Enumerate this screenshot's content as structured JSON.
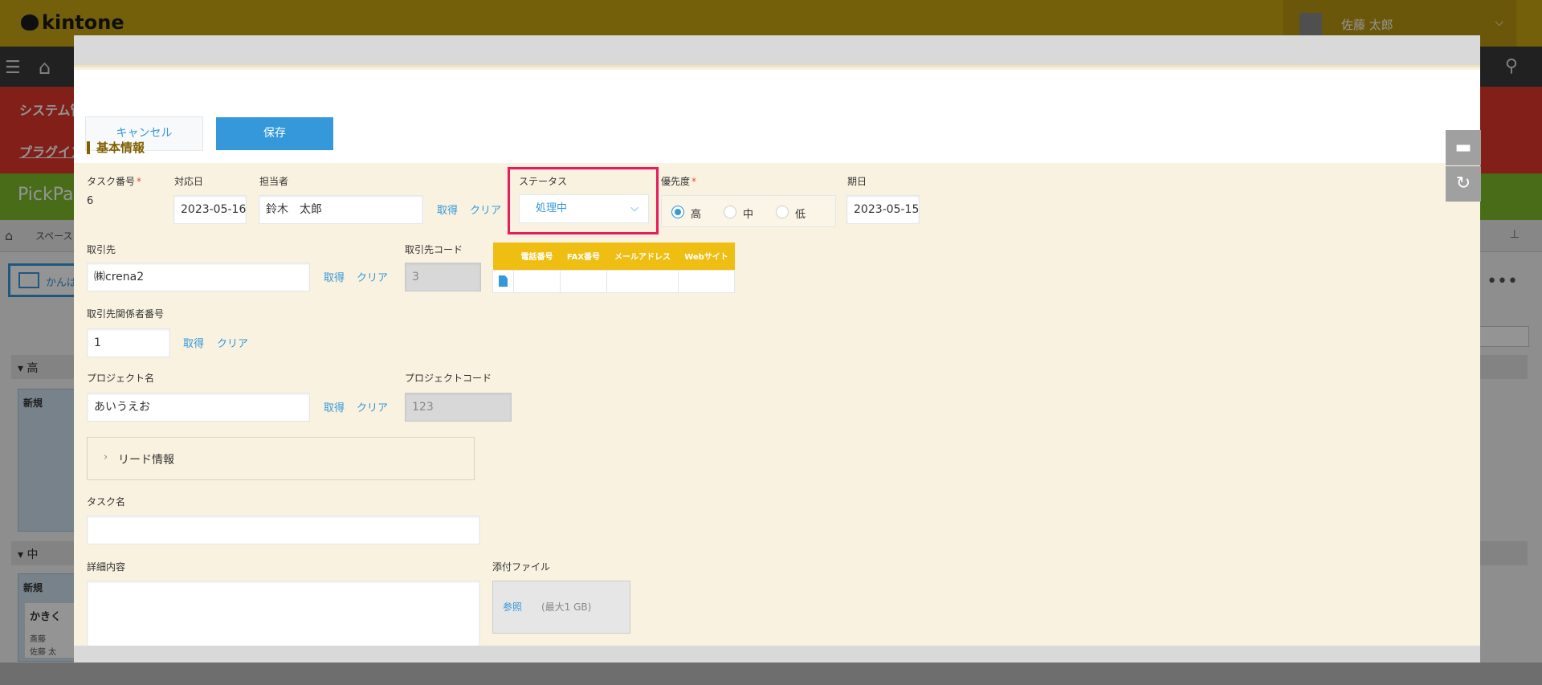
{
  "background": {
    "logo": "kintone",
    "user_name": "佐藤 太郎",
    "alert_line1": "システム管",
    "alert_line2": "プラグイン",
    "app_title": "PickPa",
    "breadcrumb": "スペース：",
    "view_label": "かんば",
    "lane_high": "高",
    "lane_mid": "中",
    "new_label": "新規",
    "card_title": "かきく",
    "card_line1": "斎藤",
    "card_line2": "佐藤 太"
  },
  "toolbar": {
    "cancel_label": "キャンセル",
    "save_label": "保存"
  },
  "section": {
    "title": "基本情報"
  },
  "fields": {
    "task_number": {
      "label": "タスク番号",
      "required": "*",
      "value": "6"
    },
    "response_date": {
      "label": "対応日",
      "value": "2023-05-16"
    },
    "assignee": {
      "label": "担当者",
      "value": "鈴木　太郎",
      "get": "取得",
      "clear": "クリア"
    },
    "status": {
      "label": "ステータス",
      "value": "処理中"
    },
    "priority": {
      "label": "優先度",
      "required": "*",
      "options": [
        "高",
        "中",
        "低"
      ],
      "selected": "高"
    },
    "due_date": {
      "label": "期日",
      "value": "2023-05-15"
    },
    "client": {
      "label": "取引先",
      "value": "㈱crena2",
      "get": "取得",
      "clear": "クリア"
    },
    "client_code": {
      "label": "取引先コード",
      "value": "3"
    },
    "client_table": {
      "headers": [
        "電話番号",
        "FAX番号",
        "メールアドレス",
        "Webサイト"
      ]
    },
    "client_contact_no": {
      "label": "取引先関係者番号",
      "value": "1",
      "get": "取得",
      "clear": "クリア"
    },
    "project_name": {
      "label": "プロジェクト名",
      "value": "あいうえお",
      "get": "取得",
      "clear": "クリア"
    },
    "project_code": {
      "label": "プロジェクトコード",
      "value": "123"
    },
    "lead_info": {
      "label": "リード情報"
    },
    "task_name": {
      "label": "タスク名",
      "value": ""
    },
    "details": {
      "label": "詳細内容",
      "value": ""
    },
    "attachment": {
      "label": "添付ファイル",
      "browse": "参照",
      "max": "(最大1 GB)"
    }
  },
  "colors": {
    "accent": "#3498db",
    "header_bg": "#c9a512",
    "modal_bg": "#f9f2e0",
    "highlight": "#e61c5d",
    "table_header": "#efbe13",
    "section_title": "#806000"
  },
  "icons": [
    "home-icon",
    "menu-icon",
    "search-icon",
    "comment-icon",
    "history-icon",
    "chevron-down-icon",
    "chevron-right-icon",
    "document-icon"
  ]
}
